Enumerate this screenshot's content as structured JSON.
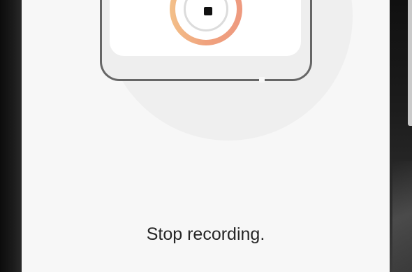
{
  "illustration": {
    "accent_gradient": [
      "#f3c089",
      "#ee9a7f"
    ],
    "stop_icon": "stop-square-icon"
  },
  "message": {
    "text": "Stop recording."
  }
}
